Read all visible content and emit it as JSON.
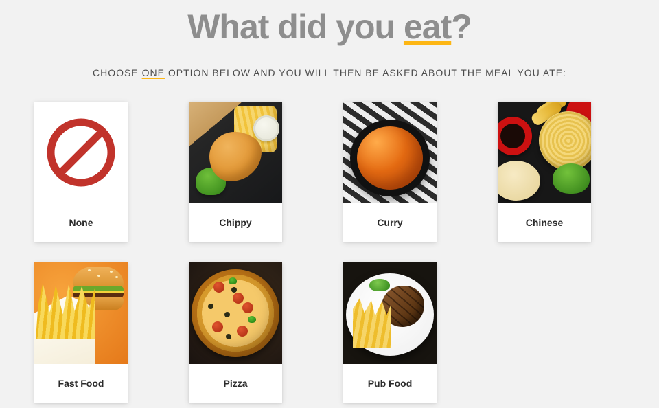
{
  "heading": {
    "prefix": "What did you ",
    "underlined": "eat",
    "suffix": "?"
  },
  "subheading": {
    "prefix": "CHOOSE ",
    "underlined": "ONE",
    "suffix": " OPTION BELOW AND YOU WILL THEN BE ASKED ABOUT THE MEAL YOU ATE:"
  },
  "options": [
    {
      "id": "none",
      "label": "None",
      "icon": "prohibition-icon"
    },
    {
      "id": "chippy",
      "label": "Chippy",
      "icon": "fish-and-chips-image"
    },
    {
      "id": "curry",
      "label": "Curry",
      "icon": "curry-bowl-image"
    },
    {
      "id": "chinese",
      "label": "Chinese",
      "icon": "chinese-food-image"
    },
    {
      "id": "fastfood",
      "label": "Fast Food",
      "icon": "burger-fries-image"
    },
    {
      "id": "pizza",
      "label": "Pizza",
      "icon": "pizza-image"
    },
    {
      "id": "pubfood",
      "label": "Pub Food",
      "icon": "steak-chips-image"
    }
  ],
  "colors": {
    "accent": "#fdb614",
    "heading": "#8e8e8e",
    "text": "#4d4d4d",
    "card_bg": "#ffffff",
    "page_bg": "#f2f2f2"
  }
}
